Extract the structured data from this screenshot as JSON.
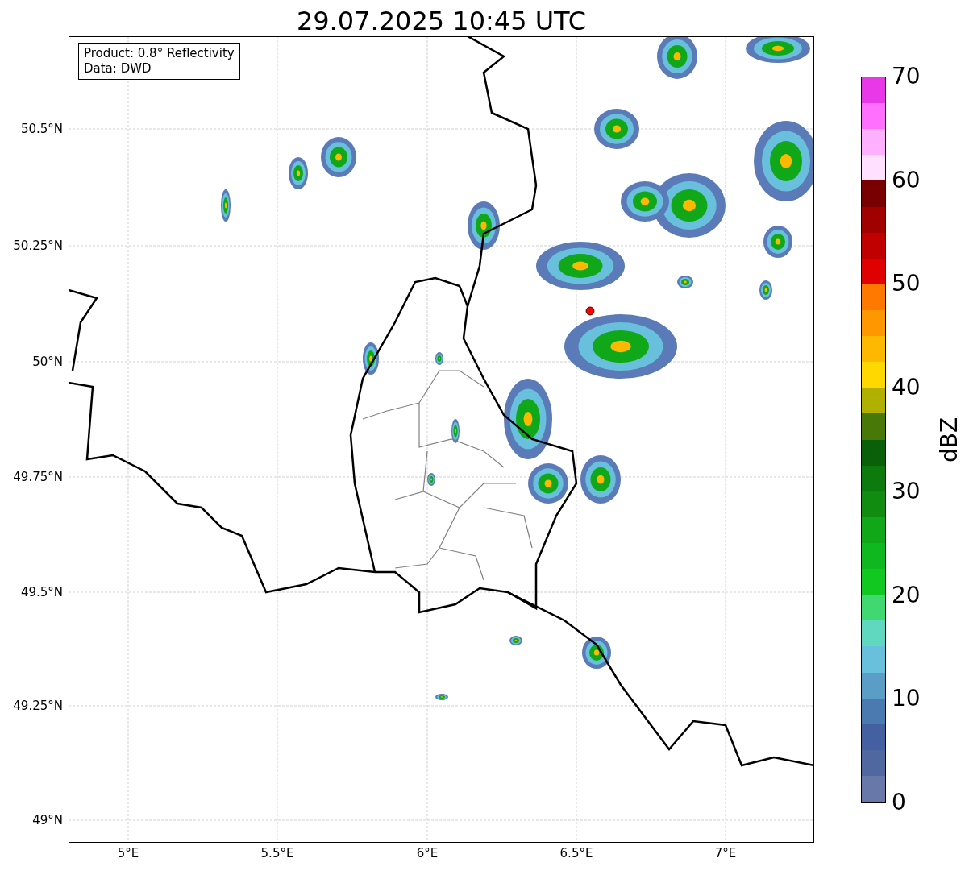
{
  "title": "29.07.2025 10:45 UTC",
  "legend": [
    "Product: 0.8° Reflectivity",
    "Data: DWD"
  ],
  "lat_ticks": [
    "50.5°N",
    "50.25°N",
    "50°N",
    "49.75°N",
    "49.5°N",
    "49.25°N",
    "49°N"
  ],
  "lon_ticks": [
    "5°E",
    "5.5°E",
    "6°E",
    "6.5°E",
    "7°E"
  ],
  "colorbar": {
    "label": "dBZ",
    "ticks": [
      "70",
      "60",
      "50",
      "40",
      "30",
      "20",
      "10",
      "0"
    ],
    "levels": [
      {
        "color": "#e838e8"
      },
      {
        "color": "#ff70ff"
      },
      {
        "color": "#ffb0ff"
      },
      {
        "color": "#ffe0ff"
      },
      {
        "color": "#780000"
      },
      {
        "color": "#a00000"
      },
      {
        "color": "#c00000"
      },
      {
        "color": "#e00000"
      },
      {
        "color": "#ff7800"
      },
      {
        "color": "#ff9800"
      },
      {
        "color": "#ffb800"
      },
      {
        "color": "#ffd800"
      },
      {
        "color": "#b0b000"
      },
      {
        "color": "#487808"
      },
      {
        "color": "#0a6008"
      },
      {
        "color": "#0c7a0c"
      },
      {
        "color": "#108c10"
      },
      {
        "color": "#10a818"
      },
      {
        "color": "#10b820"
      },
      {
        "color": "#10c820"
      },
      {
        "color": "#40d870"
      },
      {
        "color": "#60d8c0"
      },
      {
        "color": "#68c0dc"
      },
      {
        "color": "#5a9ec8"
      },
      {
        "color": "#4a7ab0"
      },
      {
        "color": "#4460a0"
      },
      {
        "color": "#5068a0"
      },
      {
        "color": "#6878a8"
      }
    ]
  }
}
